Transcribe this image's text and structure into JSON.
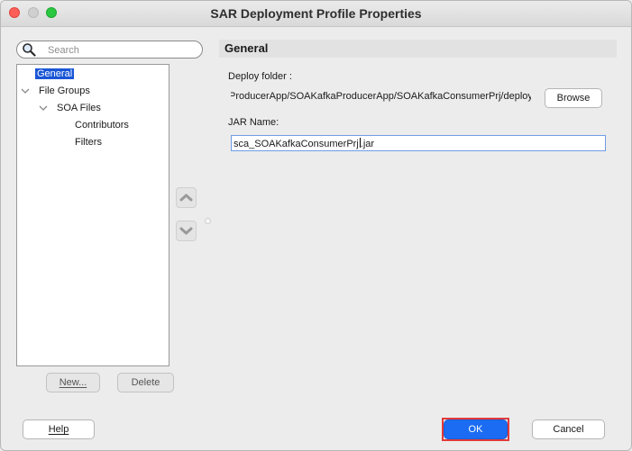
{
  "window": {
    "title": "SAR Deployment Profile Properties"
  },
  "search": {
    "placeholder": "Search",
    "value": ""
  },
  "tree": {
    "items": [
      {
        "label": "General",
        "selected": true
      },
      {
        "label": "File Groups",
        "expanded": true
      },
      {
        "label": "SOA Files",
        "expanded": true
      },
      {
        "label": "Contributors"
      },
      {
        "label": "Filters"
      }
    ]
  },
  "tree_buttons": {
    "new_label": "New...",
    "delete_label": "Delete"
  },
  "panel": {
    "header": "General",
    "deploy_folder_label": "Deploy folder :",
    "deploy_folder_value": "ProducerApp/SOAKafkaProducerApp/SOAKafkaConsumerPrj/deploy",
    "browse_label": "Browse",
    "jar_name_label": "JAR Name:",
    "jar_name_value_before_caret": "sca_SOAKafkaConsumerPrj",
    "jar_name_value_after_caret": ".jar"
  },
  "footer": {
    "help_label": "Help",
    "ok_label": "OK",
    "cancel_label": "Cancel"
  },
  "colors": {
    "accent": "#1b6cf2",
    "selection": "#1a56d6",
    "highlight_outline": "#e23a3a"
  },
  "icons": [
    "close-icon",
    "minimize-icon",
    "maximize-icon",
    "search-icon",
    "chevron-down-icon",
    "move-up-icon",
    "move-down-icon"
  ]
}
